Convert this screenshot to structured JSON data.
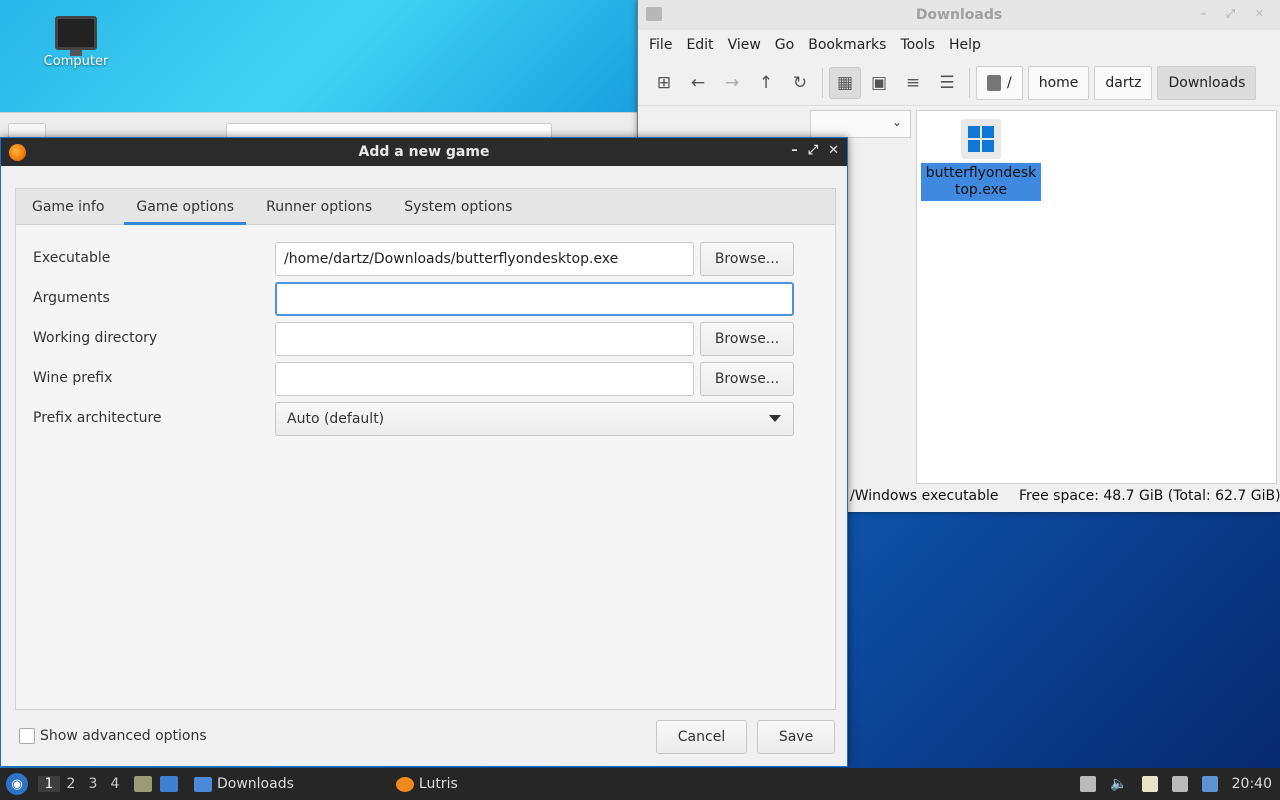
{
  "desktop": {
    "computer_label": "Computer"
  },
  "file_manager": {
    "title": "Downloads",
    "menu": [
      "File",
      "Edit",
      "View",
      "Go",
      "Bookmarks",
      "Tools",
      "Help"
    ],
    "breadcrumb": [
      "/",
      "home",
      "dartz",
      "Downloads"
    ],
    "file": {
      "name": "butterflyondesktop.exe",
      "icon": "windows-icon"
    },
    "status_type": "/Windows executable",
    "status_space": "Free space: 48.7 GiB (Total: 62.7 GiB)"
  },
  "dialog": {
    "title": "Add a new game",
    "tabs": [
      "Game info",
      "Game options",
      "Runner options",
      "System options"
    ],
    "active_tab": "Game options",
    "fields": {
      "executable_label": "Executable",
      "executable_value": "/home/dartz/Downloads/butterflyondesktop.exe",
      "arguments_label": "Arguments",
      "arguments_value": "",
      "working_dir_label": "Working directory",
      "working_dir_value": "",
      "wine_prefix_label": "Wine prefix",
      "wine_prefix_value": "",
      "prefix_arch_label": "Prefix architecture",
      "prefix_arch_value": "Auto (default)"
    },
    "browse_label": "Browse...",
    "show_advanced": "Show advanced options",
    "cancel": "Cancel",
    "save": "Save"
  },
  "taskbar": {
    "workspaces": [
      "1",
      "2",
      "3",
      "4"
    ],
    "tasks": [
      "Downloads",
      "Lutris"
    ],
    "clock": "20:40"
  },
  "colors": {
    "accent": "#3a85d6",
    "selection": "#3f8ae0",
    "taskbar": "#262626"
  }
}
